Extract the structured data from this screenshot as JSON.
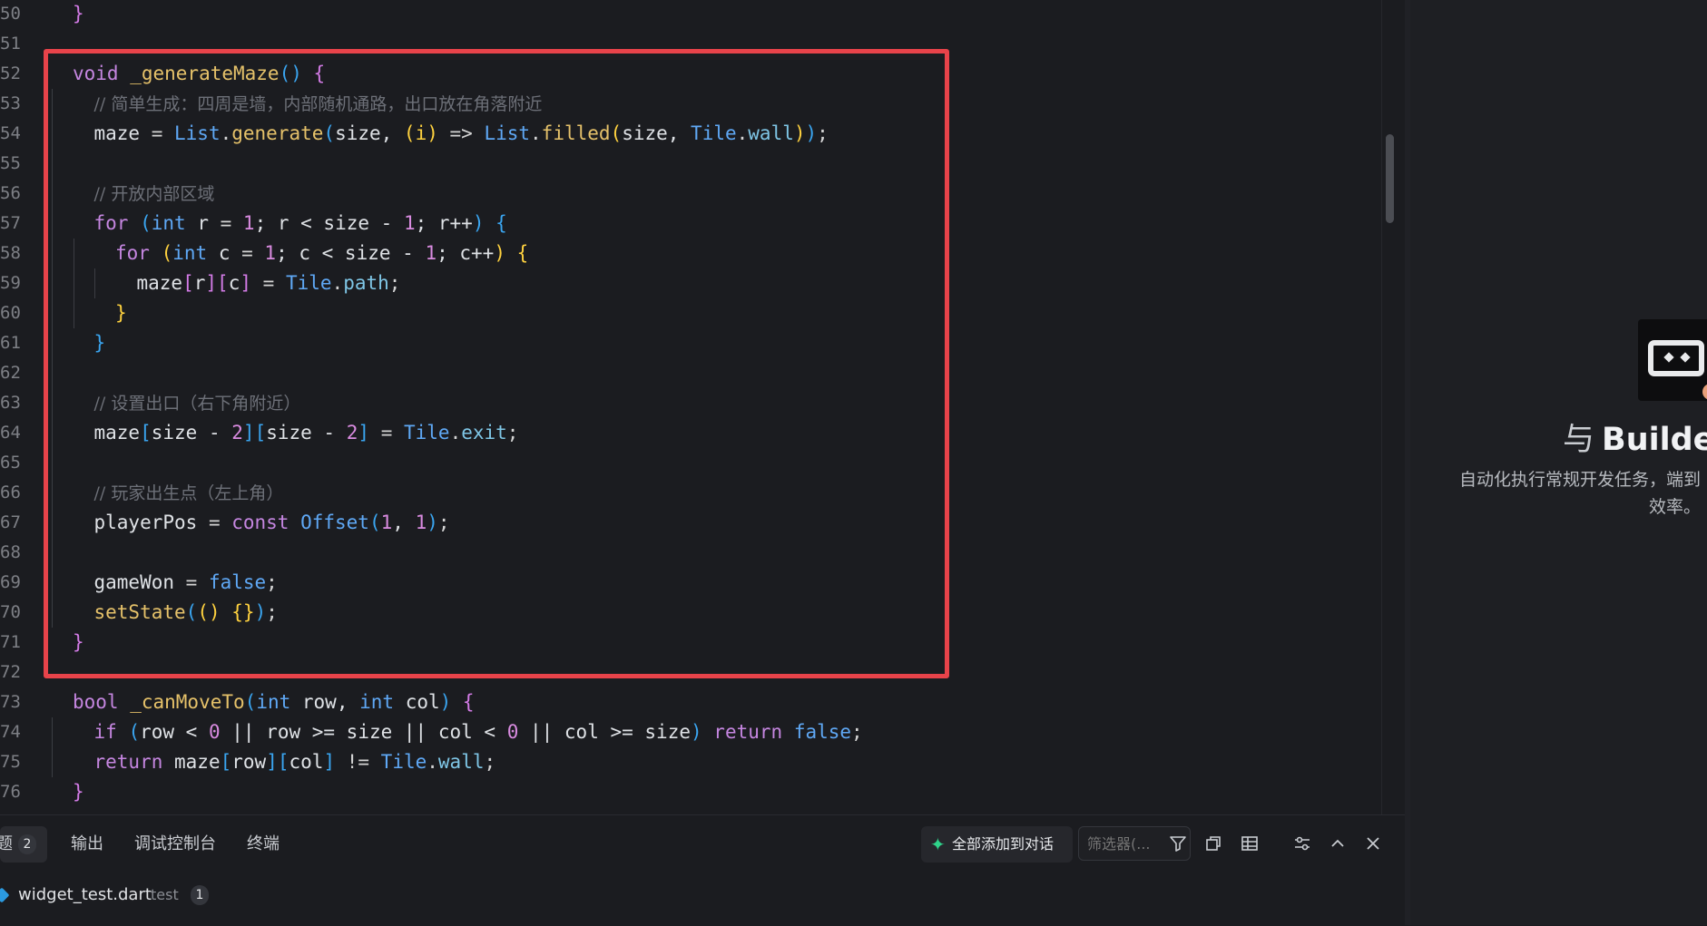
{
  "editor": {
    "lines": [
      {
        "ln": "50",
        "indent": 0,
        "tokens": [
          [
            "}",
            "b2"
          ]
        ]
      },
      {
        "ln": "51",
        "indent": 0,
        "tokens": []
      },
      {
        "ln": "52",
        "indent": 0,
        "tokens": [
          [
            "void ",
            "kw"
          ],
          [
            "_generateMaze",
            "fn"
          ],
          [
            "() ",
            "b3"
          ],
          [
            "{",
            "b2"
          ]
        ]
      },
      {
        "ln": "53",
        "indent": 1,
        "tokens": [
          [
            "// 简单生成：四周是墙，内部随机通路，出口放在角落附近",
            "cm"
          ]
        ]
      },
      {
        "ln": "54",
        "indent": 1,
        "tokens": [
          [
            "maze ",
            "vr"
          ],
          [
            "= ",
            "op"
          ],
          [
            "List",
            "ty"
          ],
          [
            ".",
            "op"
          ],
          [
            "generate",
            "fn"
          ],
          [
            "(",
            "b3"
          ],
          [
            "size, ",
            "vr"
          ],
          [
            "(i) ",
            "b1"
          ],
          [
            "=> ",
            "op"
          ],
          [
            "List",
            "ty"
          ],
          [
            ".",
            "op"
          ],
          [
            "filled",
            "fn"
          ],
          [
            "(",
            "b1"
          ],
          [
            "size, ",
            "vr"
          ],
          [
            "Tile",
            "ty"
          ],
          [
            ".",
            "op"
          ],
          [
            "wall",
            "pr"
          ],
          [
            ")",
            "b1"
          ],
          [
            ")",
            "b3"
          ],
          [
            ";",
            "op"
          ]
        ]
      },
      {
        "ln": "55",
        "indent": 1,
        "tokens": []
      },
      {
        "ln": "56",
        "indent": 1,
        "tokens": [
          [
            "// 开放内部区域",
            "cm"
          ]
        ]
      },
      {
        "ln": "57",
        "indent": 1,
        "tokens": [
          [
            "for ",
            "kw"
          ],
          [
            "(",
            "b3"
          ],
          [
            "int ",
            "ty"
          ],
          [
            "r ",
            "vr"
          ],
          [
            "= ",
            "op"
          ],
          [
            "1",
            "nm"
          ],
          [
            "; r < size - ",
            "vr"
          ],
          [
            "1",
            "nm"
          ],
          [
            "; r++",
            "vr"
          ],
          [
            ") ",
            "b3"
          ],
          [
            "{",
            "b3"
          ]
        ]
      },
      {
        "ln": "58",
        "indent": 2,
        "tokens": [
          [
            "for ",
            "kw"
          ],
          [
            "(",
            "b1"
          ],
          [
            "int ",
            "ty"
          ],
          [
            "c ",
            "vr"
          ],
          [
            "= ",
            "op"
          ],
          [
            "1",
            "nm"
          ],
          [
            "; c < size - ",
            "vr"
          ],
          [
            "1",
            "nm"
          ],
          [
            "; c++",
            "vr"
          ],
          [
            ") ",
            "b1"
          ],
          [
            "{",
            "b1"
          ]
        ]
      },
      {
        "ln": "59",
        "indent": 3,
        "tokens": [
          [
            "maze",
            "vr"
          ],
          [
            "[",
            "b2"
          ],
          [
            "r",
            "vr"
          ],
          [
            "]",
            "b2"
          ],
          [
            "[",
            "b2"
          ],
          [
            "c",
            "vr"
          ],
          [
            "] ",
            "b2"
          ],
          [
            "= ",
            "op"
          ],
          [
            "Tile",
            "ty"
          ],
          [
            ".",
            "op"
          ],
          [
            "path",
            "pr"
          ],
          [
            ";",
            "op"
          ]
        ]
      },
      {
        "ln": "60",
        "indent": 2,
        "tokens": [
          [
            "}",
            "b1"
          ]
        ]
      },
      {
        "ln": "61",
        "indent": 1,
        "tokens": [
          [
            "}",
            "b3"
          ]
        ]
      },
      {
        "ln": "62",
        "indent": 1,
        "tokens": []
      },
      {
        "ln": "63",
        "indent": 1,
        "tokens": [
          [
            "// 设置出口（右下角附近）",
            "cm"
          ]
        ]
      },
      {
        "ln": "64",
        "indent": 1,
        "tokens": [
          [
            "maze",
            "vr"
          ],
          [
            "[",
            "b3"
          ],
          [
            "size - ",
            "vr"
          ],
          [
            "2",
            "nm"
          ],
          [
            "]",
            "b3"
          ],
          [
            "[",
            "b3"
          ],
          [
            "size - ",
            "vr"
          ],
          [
            "2",
            "nm"
          ],
          [
            "] ",
            "b3"
          ],
          [
            "= ",
            "op"
          ],
          [
            "Tile",
            "ty"
          ],
          [
            ".",
            "op"
          ],
          [
            "exit",
            "pr"
          ],
          [
            ";",
            "op"
          ]
        ]
      },
      {
        "ln": "65",
        "indent": 1,
        "tokens": []
      },
      {
        "ln": "66",
        "indent": 1,
        "tokens": [
          [
            "// 玩家出生点（左上角）",
            "cm"
          ]
        ]
      },
      {
        "ln": "67",
        "indent": 1,
        "tokens": [
          [
            "playerPos ",
            "vr"
          ],
          [
            "= ",
            "op"
          ],
          [
            "const ",
            "kw"
          ],
          [
            "Offset",
            "ty"
          ],
          [
            "(",
            "b3"
          ],
          [
            "1",
            "nm"
          ],
          [
            ", ",
            "vr"
          ],
          [
            "1",
            "nm"
          ],
          [
            ")",
            "b3"
          ],
          [
            ";",
            "op"
          ]
        ]
      },
      {
        "ln": "68",
        "indent": 1,
        "tokens": []
      },
      {
        "ln": "69",
        "indent": 1,
        "tokens": [
          [
            "gameWon ",
            "vr"
          ],
          [
            "= ",
            "op"
          ],
          [
            "false",
            "ty"
          ],
          [
            ";",
            "op"
          ]
        ]
      },
      {
        "ln": "70",
        "indent": 1,
        "tokens": [
          [
            "setState",
            "fn"
          ],
          [
            "(",
            "b3"
          ],
          [
            "() ",
            "b1"
          ],
          [
            "{",
            "b1"
          ],
          [
            "}",
            "b1"
          ],
          [
            ")",
            "b3"
          ],
          [
            ";",
            "op"
          ]
        ]
      },
      {
        "ln": "71",
        "indent": 0,
        "tokens": [
          [
            "}",
            "b2"
          ]
        ]
      },
      {
        "ln": "72",
        "indent": 0,
        "tokens": []
      },
      {
        "ln": "73",
        "indent": 0,
        "tokens": [
          [
            "bool ",
            "kw"
          ],
          [
            "_canMoveTo",
            "fn"
          ],
          [
            "(",
            "b3"
          ],
          [
            "int ",
            "ty"
          ],
          [
            "row, ",
            "vr"
          ],
          [
            "int ",
            "ty"
          ],
          [
            "col",
            "vr"
          ],
          [
            ") ",
            "b3"
          ],
          [
            "{",
            "b2"
          ]
        ]
      },
      {
        "ln": "74",
        "indent": 1,
        "tokens": [
          [
            "if ",
            "kw"
          ],
          [
            "(",
            "b3"
          ],
          [
            "row < ",
            "vr"
          ],
          [
            "0",
            "nm"
          ],
          [
            " || row >= size || col < ",
            "vr"
          ],
          [
            "0",
            "nm"
          ],
          [
            " || col >= size",
            "vr"
          ],
          [
            ") ",
            "b3"
          ],
          [
            "return ",
            "kw"
          ],
          [
            "false",
            "ty"
          ],
          [
            ";",
            "op"
          ]
        ]
      },
      {
        "ln": "75",
        "indent": 1,
        "tokens": [
          [
            "return ",
            "kw"
          ],
          [
            "maze",
            "vr"
          ],
          [
            "[",
            "b3"
          ],
          [
            "row",
            "vr"
          ],
          [
            "]",
            "b3"
          ],
          [
            "[",
            "b3"
          ],
          [
            "col",
            "vr"
          ],
          [
            "] ",
            "b3"
          ],
          [
            "!= ",
            "op"
          ],
          [
            "Tile",
            "ty"
          ],
          [
            ".",
            "op"
          ],
          [
            "wall",
            "pr"
          ],
          [
            ";",
            "op"
          ]
        ]
      },
      {
        "ln": "76",
        "indent": 0,
        "tokens": [
          [
            "}",
            "b2"
          ]
        ]
      }
    ]
  },
  "panel": {
    "tabs": {
      "problems": {
        "label": "题",
        "count": "2"
      },
      "output": "输出",
      "debug_console": "调试控制台",
      "terminal": "终端"
    },
    "add_all_label": "全部添加到对话",
    "filter_placeholder": "筛选器(...",
    "file_row": {
      "name": "widget_test.dart",
      "dir": "test",
      "count": "1"
    }
  },
  "side_panel": {
    "yu": "与",
    "title": "Builder",
    "desc_line1": "自动化执行常规开发任务，端到",
    "desc_line2": "效率。"
  }
}
